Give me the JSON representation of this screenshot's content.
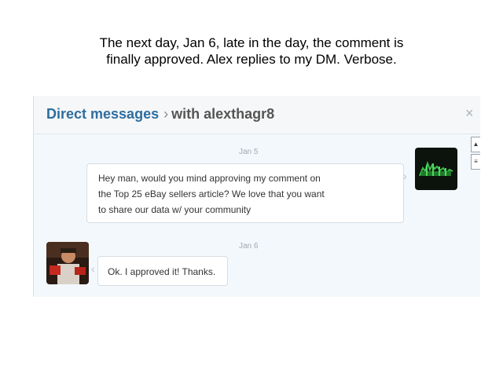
{
  "caption": {
    "line1": "The next day, Jan 6, late in the day, the comment is",
    "line2": "finally approved.  Alex replies to my DM.  Verbose."
  },
  "dm_panel": {
    "title": "Direct messages",
    "separator": "›",
    "with_label": "with alexthagr8",
    "close_icon": "×",
    "scroll_up_icon": "▲",
    "scroll_grip_icon": "≡"
  },
  "messages": [
    {
      "date": "Jan 5",
      "lines": [
        "Hey man, would you mind approving my comment on",
        "the Top 25 eBay sellers article?  We love that you want",
        "to share our data w/ your community"
      ],
      "side": "right",
      "avatar_icon": "green-chart-avatar"
    },
    {
      "date": "Jan 6",
      "lines": [
        "Ok. I approved it! Thanks."
      ],
      "side": "left",
      "avatar_icon": "person-photo-avatar"
    }
  ],
  "colors": {
    "title_blue": "#2d6ea0",
    "panel_bg": "#f3f8fc"
  }
}
